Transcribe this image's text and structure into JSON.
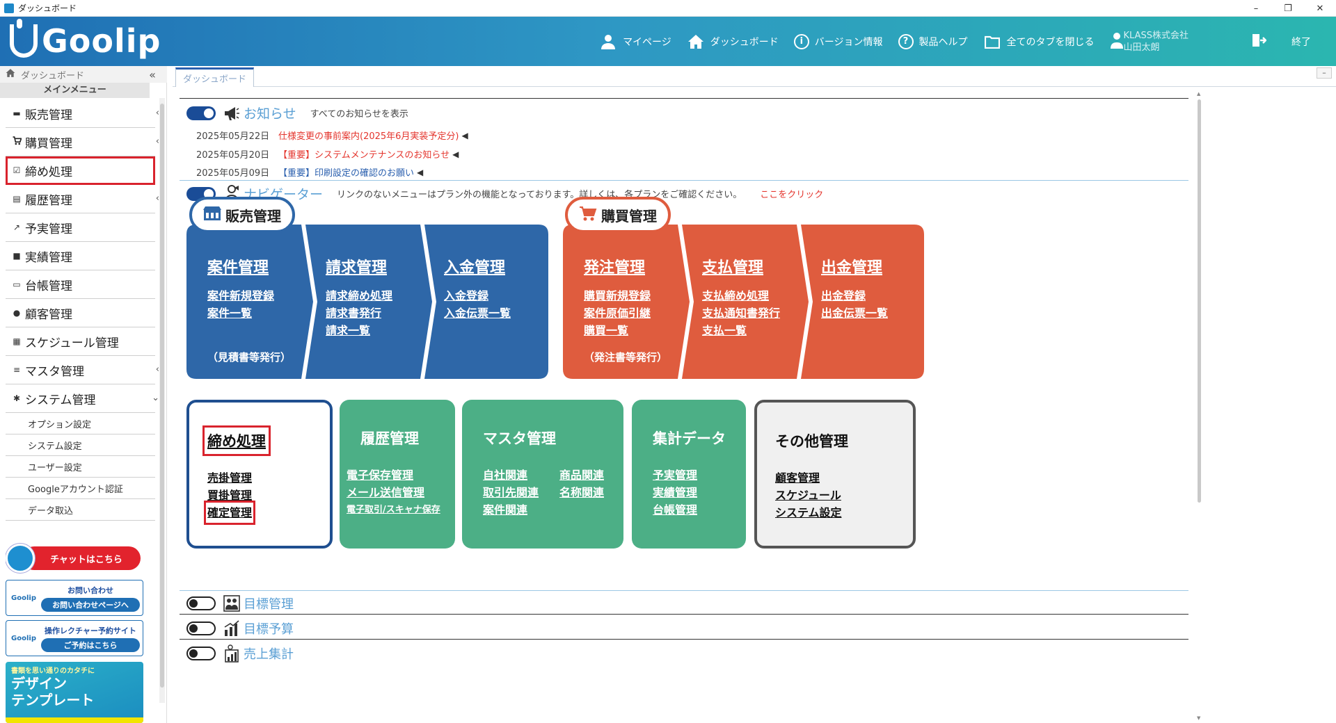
{
  "window": {
    "title": "ダッシュボード",
    "minimize": "–",
    "restore": "❐",
    "close": "✕"
  },
  "header": {
    "logo_text": "Goolip",
    "nav": [
      {
        "label": "マイページ",
        "icon": "person-icon"
      },
      {
        "label": "ダッシュボード",
        "icon": "home-icon"
      },
      {
        "label": "バージョン情報",
        "icon": "info-icon"
      },
      {
        "label": "製品ヘルプ",
        "icon": "help-icon"
      },
      {
        "label": "全てのタブを閉じる",
        "icon": "folder-icon"
      }
    ],
    "company": "KLASS株式会社",
    "user": "山田太朗",
    "exit_label": "終了"
  },
  "sidebar": {
    "breadcrumb": "ダッシュボード",
    "collapse": "«",
    "main_menu": "メインメニュー",
    "items": [
      {
        "label": "販売管理",
        "icon": "register-icon",
        "glyph": "▬",
        "chevron": "‹"
      },
      {
        "label": "購買管理",
        "icon": "cart-icon",
        "glyph": "🛒",
        "chevron": "‹"
      },
      {
        "label": "締め処理",
        "icon": "checkbox-icon",
        "glyph": "☑",
        "chevron": ""
      },
      {
        "label": "履歴管理",
        "icon": "history-icon",
        "glyph": "▤",
        "chevron": "‹"
      },
      {
        "label": "予実管理",
        "icon": "chart-icon",
        "glyph": "↗",
        "chevron": ""
      },
      {
        "label": "実績管理",
        "icon": "bookmark-icon",
        "glyph": "■",
        "chevron": ""
      },
      {
        "label": "台帳管理",
        "icon": "book-icon",
        "glyph": "▭",
        "chevron": ""
      },
      {
        "label": "顧客管理",
        "icon": "users-icon",
        "glyph": "●",
        "chevron": ""
      },
      {
        "label": "スケジュール管理",
        "icon": "calendar-icon",
        "glyph": "▦",
        "chevron": ""
      },
      {
        "label": "マスタ管理",
        "icon": "database-icon",
        "glyph": "≡",
        "chevron": "‹"
      },
      {
        "label": "システム管理",
        "icon": "gear-icon",
        "glyph": "✱",
        "chevron": "⌄"
      }
    ],
    "sub_items": [
      "オプション設定",
      "システム設定",
      "ユーザー設定",
      "Googleアカウント認証",
      "データ取込"
    ],
    "banners": {
      "chat": "チャットはこちら",
      "contact_logo": "Goolip",
      "contact_top": "お問い合わせ",
      "contact_btn": "お問い合わせページへ",
      "lecture_logo": "Goolip",
      "lecture_top": "操作レクチャー予約サイト",
      "lecture_btn": "ご予約はこちら",
      "design_small": "書類を思い通りのカタチに",
      "design_big1": "デザイン",
      "design_big2": "テンプレート"
    }
  },
  "main": {
    "tab": "ダッシュボード",
    "tab_min": "–",
    "notice": {
      "title": "お知らせ",
      "show_all": "すべてのお知らせを表示",
      "items": [
        {
          "date": "2025年05月22日",
          "title": "仕様変更の事前案内(2025年6月実装予定分)",
          "color": "#e4352d"
        },
        {
          "date": "2025年05月20日",
          "title": "【重要】システムメンテナンスのお知らせ",
          "color": "#e4352d"
        },
        {
          "date": "2025年05月09日",
          "title": "【重要】印刷設定の確認のお願い",
          "color": "#2a5fae"
        }
      ]
    },
    "navigator": {
      "title": "ナビゲーター",
      "desc": "リンクのないメニューはプラン外の機能となっております。詳しくは、各プランをご確認ください。",
      "link": "ここをクリック",
      "sales_group": "販売管理",
      "purchase_group": "購買管理",
      "chevrons": [
        {
          "title": "案件管理",
          "links": [
            "案件新規登録",
            "案件一覧"
          ],
          "note": "（見積書等発行）"
        },
        {
          "title": "請求管理",
          "links": [
            "請求締め処理",
            "請求書発行",
            "請求一覧"
          ],
          "note": ""
        },
        {
          "title": "入金管理",
          "links": [
            "入金登録",
            "入金伝票一覧"
          ],
          "note": ""
        },
        {
          "title": "発注管理",
          "links": [
            "購買新規登録",
            "案件原価引継",
            "購買一覧"
          ],
          "note": "（発注書等発行）"
        },
        {
          "title": "支払管理",
          "links": [
            "支払締め処理",
            "支払通知書発行",
            "支払一覧"
          ],
          "note": ""
        },
        {
          "title": "出金管理",
          "links": [
            "出金登録",
            "出金伝票一覧"
          ],
          "note": ""
        }
      ],
      "tiles": {
        "closing": {
          "title": "締め処理",
          "links": [
            "売掛管理",
            "買掛管理",
            "確定管理"
          ]
        },
        "history": {
          "title": "履歴管理",
          "links": [
            "電子保存管理",
            "メール送信管理",
            "電子取引/スキャナ保存"
          ]
        },
        "master": {
          "title": "マスタ管理",
          "col1": [
            "自社関連",
            "取引先関連",
            "案件関連"
          ],
          "col2": [
            "商品関連",
            "名称関連"
          ]
        },
        "aggregate": {
          "title": "集計データ",
          "links": [
            "予実管理",
            "実績管理",
            "台帳管理"
          ]
        },
        "other": {
          "title": "その他管理",
          "links": [
            "顧客管理",
            "スケジュール",
            "システム設定"
          ]
        }
      }
    },
    "bottom_sections": [
      {
        "label": "目標管理",
        "icon": "team-icon"
      },
      {
        "label": "目標予算",
        "icon": "bar-chart-icon"
      },
      {
        "label": "売上集計",
        "icon": "building-chart-icon"
      }
    ]
  }
}
